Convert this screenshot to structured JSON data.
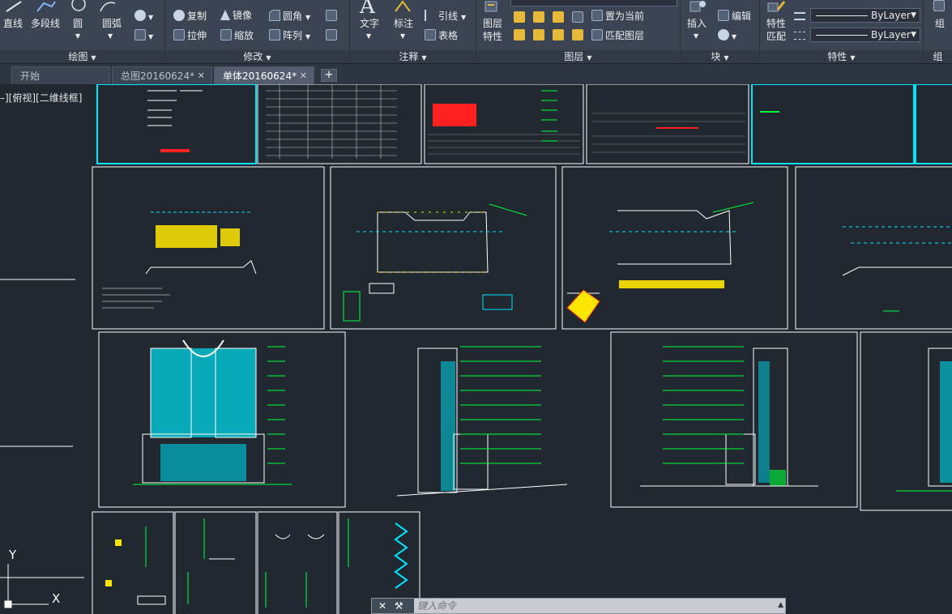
{
  "ribbon": {
    "draw": {
      "group_label": "绘图",
      "line": "直线",
      "polyline": "多段线",
      "circle": "圆",
      "arc": "圆弧"
    },
    "modify": {
      "group_label": "修改",
      "copy": "复制",
      "mirror": "镜像",
      "fillet": "圆角",
      "stretch": "拉伸",
      "scale": "缩放",
      "array": "阵列"
    },
    "annotation": {
      "group_label": "注释",
      "text": "文字",
      "dimension": "标注",
      "leader": "引线",
      "table": "表格"
    },
    "layers": {
      "group_label": "图层",
      "layer_properties_line1": "图层",
      "layer_properties_line2": "特性",
      "set_current": "置为当前",
      "match_layer": "匹配图层"
    },
    "block": {
      "group_label": "块",
      "insert": "插入",
      "edit": "编辑"
    },
    "properties": {
      "group_label": "特性",
      "match_line1": "特性",
      "match_line2": "匹配",
      "linetype": "ByLayer",
      "lineweight": "ByLayer"
    },
    "groups": {
      "group_label": "组"
    }
  },
  "tabs": [
    {
      "label": "开始"
    },
    {
      "label": "总图20160624*"
    },
    {
      "label": "单体20160624*"
    }
  ],
  "viewport": {
    "view_label": "–][俯视][二维线框]",
    "ucs_x": "X",
    "ucs_y": "Y"
  },
  "command_line": {
    "placeholder": "键入命令"
  },
  "colors": {
    "ribbon_bg": "#3b4453",
    "canvas_bg": "#212830",
    "sheet_border": "#ffffff",
    "cyan": "#00e5ff",
    "green": "#00ff3c",
    "yellow": "#ffe600",
    "red": "#ff2020"
  }
}
